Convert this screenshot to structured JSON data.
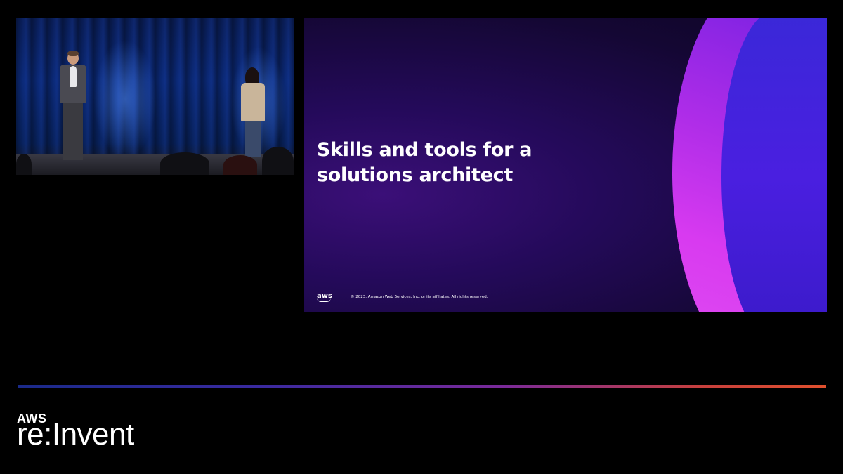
{
  "slide": {
    "title_line1": "Skills and tools for a",
    "title_line2": "solutions architect",
    "logo_text": "aws",
    "copyright": "© 2023, Amazon Web Services, Inc. or its affiliates. All rights reserved."
  },
  "branding": {
    "aws": "AWS",
    "event": "re:Invent"
  },
  "colors": {
    "background": "#000000",
    "slide_bg": "#1c0a45",
    "swoosh_magenta": "#d83af0",
    "swoosh_blue": "#3a28d8",
    "progress_start": "#1a2a8a",
    "progress_end": "#e0502e"
  },
  "icons": {
    "aws_logo": "aws-smile-logo"
  }
}
